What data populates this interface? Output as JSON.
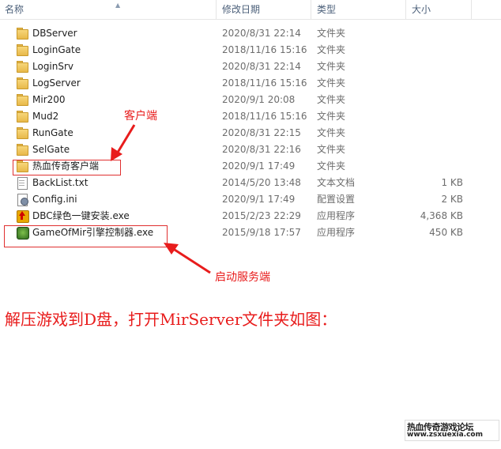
{
  "columns": {
    "name": "名称",
    "date": "修改日期",
    "type": "类型",
    "size": "大小"
  },
  "files": [
    {
      "icon": "folder-icon",
      "name": "DBServer",
      "date": "2020/8/31 22:14",
      "type": "文件夹",
      "size": ""
    },
    {
      "icon": "folder-icon",
      "name": "LoginGate",
      "date": "2018/11/16 15:16",
      "type": "文件夹",
      "size": ""
    },
    {
      "icon": "folder-icon",
      "name": "LoginSrv",
      "date": "2020/8/31 22:14",
      "type": "文件夹",
      "size": ""
    },
    {
      "icon": "folder-icon",
      "name": "LogServer",
      "date": "2018/11/16 15:16",
      "type": "文件夹",
      "size": ""
    },
    {
      "icon": "folder-icon",
      "name": "Mir200",
      "date": "2020/9/1 20:08",
      "type": "文件夹",
      "size": ""
    },
    {
      "icon": "folder-icon",
      "name": "Mud2",
      "date": "2018/11/16 15:16",
      "type": "文件夹",
      "size": ""
    },
    {
      "icon": "folder-icon",
      "name": "RunGate",
      "date": "2020/8/31 22:15",
      "type": "文件夹",
      "size": ""
    },
    {
      "icon": "folder-icon",
      "name": "SelGate",
      "date": "2020/8/31 22:16",
      "type": "文件夹",
      "size": ""
    },
    {
      "icon": "folder-icon",
      "name": "热血传奇客户端",
      "date": "2020/9/1 17:49",
      "type": "文件夹",
      "size": ""
    },
    {
      "icon": "text-file-icon",
      "name": "BackList.txt",
      "date": "2014/5/20 13:48",
      "type": "文本文档",
      "size": "1 KB"
    },
    {
      "icon": "config-file-icon",
      "name": "Config.ini",
      "date": "2020/9/1 17:49",
      "type": "配置设置",
      "size": "2 KB"
    },
    {
      "icon": "installer-icon",
      "name": "DBC绿色一键安装.exe",
      "date": "2015/2/23 22:29",
      "type": "应用程序",
      "size": "4,368 KB"
    },
    {
      "icon": "game-app-icon",
      "name": "GameOfMir引擎控制器.exe",
      "date": "2015/9/18 17:57",
      "type": "应用程序",
      "size": "450 KB"
    }
  ],
  "annotations": {
    "client_label": "客户端",
    "server_label": "启动服务端",
    "caption": "解压游戏到D盘，打开MirServer文件夹如图："
  },
  "watermark": {
    "line1": "热血传奇游戏论坛",
    "line2": "www.zsxuexia.com"
  },
  "colors": {
    "annotation": "#e81c1c",
    "header_text": "#4c607a",
    "folder": "#e8b94a"
  }
}
